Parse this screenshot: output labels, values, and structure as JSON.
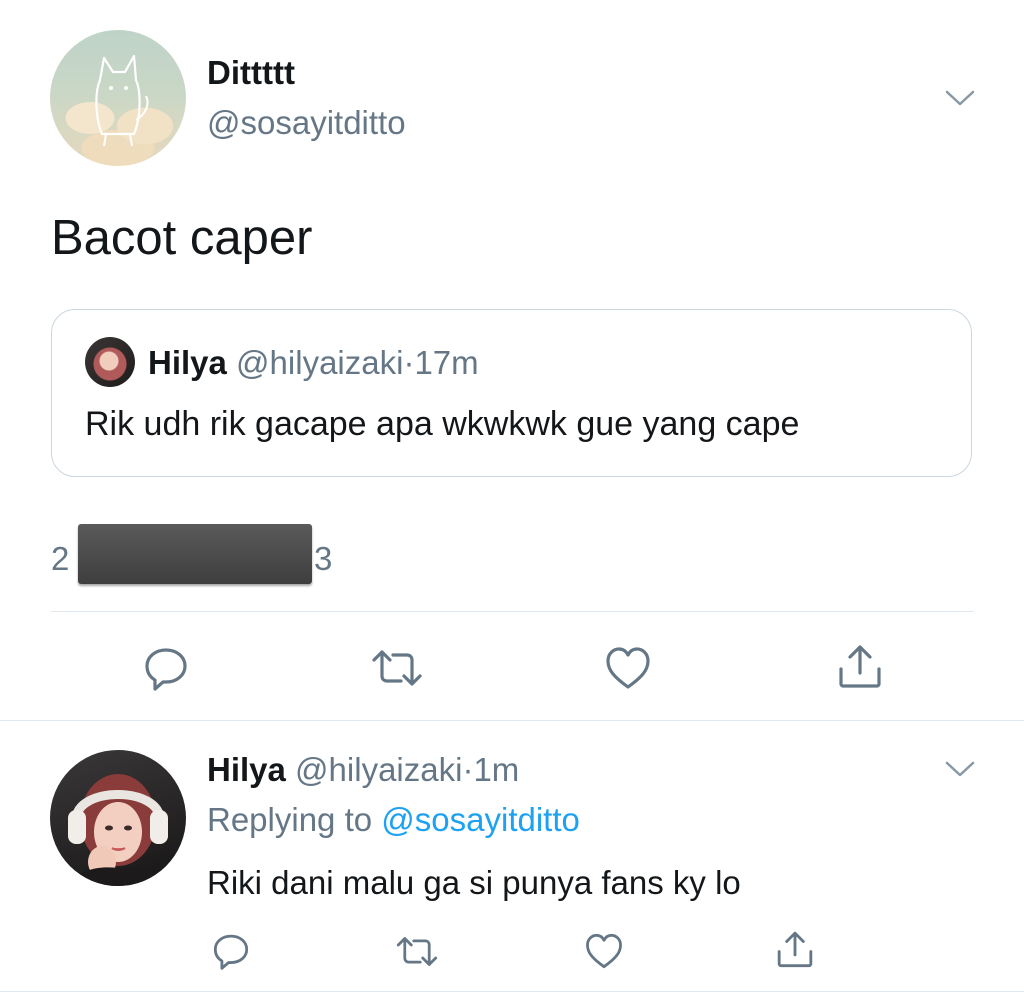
{
  "main_tweet": {
    "display_name": "Dittttt",
    "handle": "@sosayitditto",
    "text": "Bacot caper",
    "stats_left": "2",
    "stats_right": "3"
  },
  "quoted_tweet": {
    "display_name": "Hilya",
    "handle": "@hilyaizaki",
    "separator": "·",
    "time": "17m",
    "text": "Rik udh rik gacape apa wkwkwk gue yang cape"
  },
  "reply_tweet": {
    "display_name": "Hilya",
    "handle": "@hilyaizaki",
    "separator": "·",
    "time": "1m",
    "replying_prefix": "Replying to",
    "replying_to": "@sosayitditto",
    "text": "Riki dani malu ga si punya fans ky lo"
  },
  "icons": {
    "reply": "reply-icon",
    "retweet": "retweet-icon",
    "like": "like-icon",
    "share": "share-icon",
    "menu": "chevron-down-icon"
  },
  "colors": {
    "link": "#1da1f2",
    "secondary": "#657786",
    "icon": "#657786",
    "border": "#ccd6dd"
  }
}
